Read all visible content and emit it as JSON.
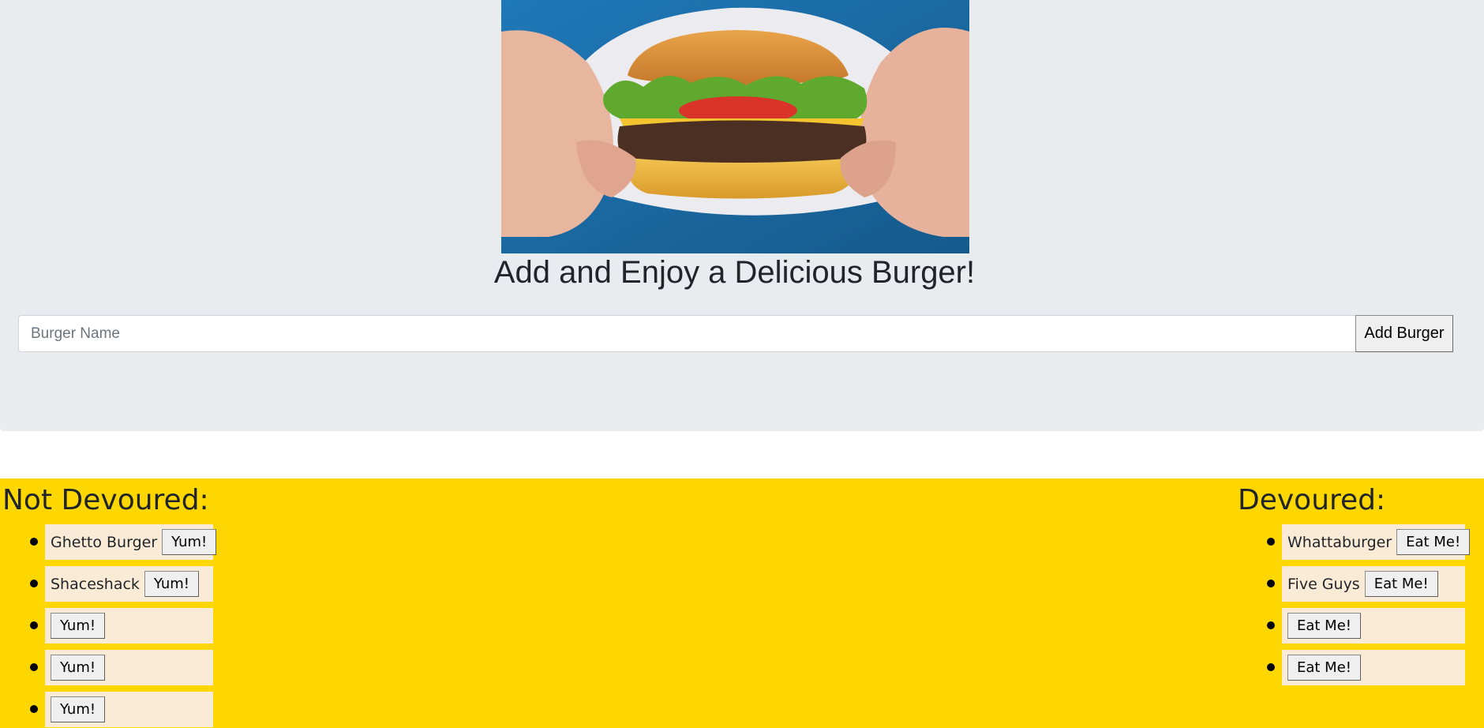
{
  "hero": {
    "heading": "Add and Enjoy a Delicious Burger!"
  },
  "form": {
    "placeholder": "Burger Name",
    "submit_label": "Add Burger"
  },
  "not_devoured": {
    "heading": "Not Devoured:",
    "button_label": "Yum!",
    "items": [
      {
        "name": "Ghetto Burger"
      },
      {
        "name": "Shaceshack"
      },
      {
        "name": ""
      },
      {
        "name": ""
      },
      {
        "name": ""
      }
    ]
  },
  "devoured": {
    "heading": "Devoured:",
    "button_label": "Eat Me!",
    "items": [
      {
        "name": "Whattaburger"
      },
      {
        "name": "Five Guys"
      },
      {
        "name": ""
      },
      {
        "name": ""
      }
    ]
  },
  "colors": {
    "jumbotron_bg": "#e9ecef",
    "section_bg": "#ffd700",
    "item_bg": "#faebd7"
  }
}
